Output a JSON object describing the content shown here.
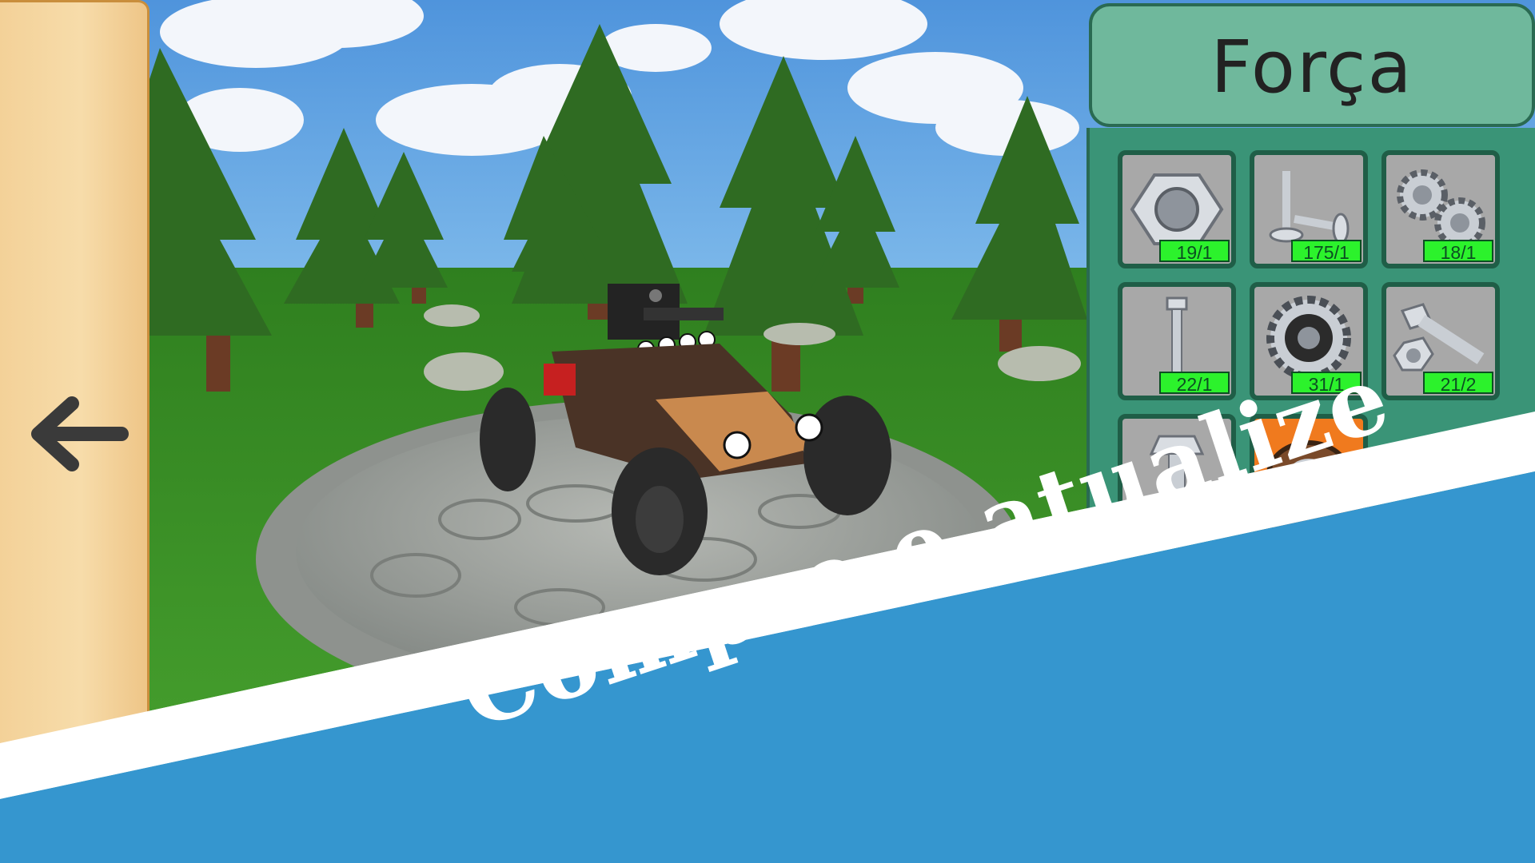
{
  "colors": {
    "sky": "#5aa0e0",
    "grass": "#3f9a2a",
    "panel_accent": "#6fb89c",
    "panel_dark": "#2a6a52",
    "badge": "#2cf22c",
    "banner_blue": "#3596cf",
    "selected_slot": "#f07a1e"
  },
  "back_button": {
    "icon": "arrow-left-icon"
  },
  "panel": {
    "title": "Força",
    "items": [
      {
        "name": "hex-nut",
        "icon": "hex-nut-icon",
        "count": "19/1"
      },
      {
        "name": "screws",
        "icon": "screws-icon",
        "count": "175/1"
      },
      {
        "name": "gear-nuts",
        "icon": "gear-nuts-icon",
        "count": "18/1"
      },
      {
        "name": "long-bolt",
        "icon": "long-bolt-icon",
        "count": "22/1"
      },
      {
        "name": "gear-wheel",
        "icon": "gear-wheel-icon",
        "count": "31/1"
      },
      {
        "name": "bolt-and-nut",
        "icon": "bolt-and-nut-icon",
        "count": "21/2"
      },
      {
        "name": "hex-bolt",
        "icon": "hex-bolt-icon",
        "count": ""
      },
      {
        "name": "bearing",
        "icon": "bearing-icon",
        "count": "",
        "selected": true
      }
    ]
  },
  "banner": {
    "text": "Compre e atualize"
  }
}
